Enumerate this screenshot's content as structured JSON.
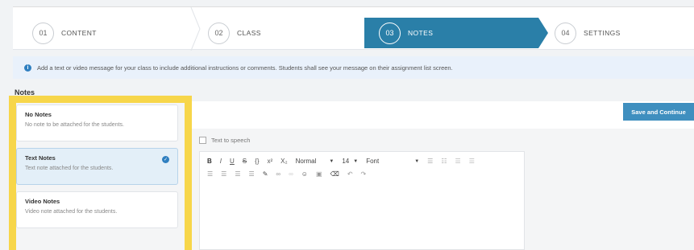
{
  "stepper": {
    "steps": [
      {
        "num": "01",
        "label": "CONTENT"
      },
      {
        "num": "02",
        "label": "CLASS"
      },
      {
        "num": "03",
        "label": "NOTES"
      },
      {
        "num": "04",
        "label": "SETTINGS"
      }
    ],
    "active_index": 2
  },
  "info": {
    "icon": "info-icon",
    "text": "Add a text or video message for your class to include additional instructions or comments. Students shall see your message on their assignment list screen."
  },
  "notes": {
    "section_title": "Notes",
    "options": [
      {
        "title": "No Notes",
        "desc": "No note to be attached for the students.",
        "selected": false
      },
      {
        "title": "Text Notes",
        "desc": "Text note attached for the students.",
        "selected": true
      },
      {
        "title": "Video Notes",
        "desc": "Video note attached for the students.",
        "selected": false
      }
    ]
  },
  "actions": {
    "save_label": "Save and Continue"
  },
  "editor": {
    "tts_label": "Text to speech",
    "format": "Normal",
    "size": "14",
    "font": "Font"
  },
  "colors": {
    "accent": "#2a7fa8",
    "highlight": "#f7d64a",
    "button": "#3f8fbf"
  }
}
